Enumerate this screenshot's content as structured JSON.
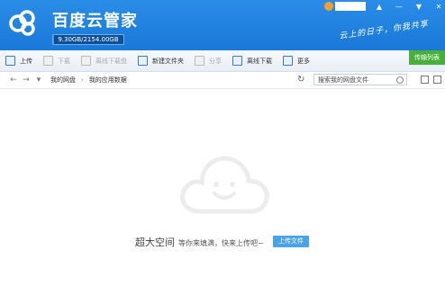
{
  "app": {
    "title": "百度云管家",
    "quota": "9.30GB/2154.00GB",
    "quota_fill": 0.004,
    "slogan": "云上的日子，你我共享"
  },
  "window_controls": [
    "▲",
    "—",
    "▼",
    "✕"
  ],
  "toolbar": {
    "items": [
      {
        "label": "上传",
        "disabled": false
      },
      {
        "label": "下载",
        "disabled": true
      },
      {
        "label": "离线下载盘",
        "disabled": true
      },
      {
        "label": "新建文件夹",
        "disabled": false
      },
      {
        "label": "分享",
        "disabled": true
      },
      {
        "label": "离线下载",
        "disabled": false
      },
      {
        "label": "更多",
        "disabled": false
      }
    ],
    "transfer": "传输列表"
  },
  "nav": {
    "back": "←",
    "forward": "→",
    "dropdown": "▾",
    "crumbs": [
      "我的网盘",
      "我的应用数据"
    ],
    "separator": "›",
    "refresh": "↻",
    "search_placeholder": "搜索我的网盘文件"
  },
  "empty": {
    "big": "超大空间",
    "text": "等你来填满，快来上传吧~",
    "button": "上传文件"
  }
}
